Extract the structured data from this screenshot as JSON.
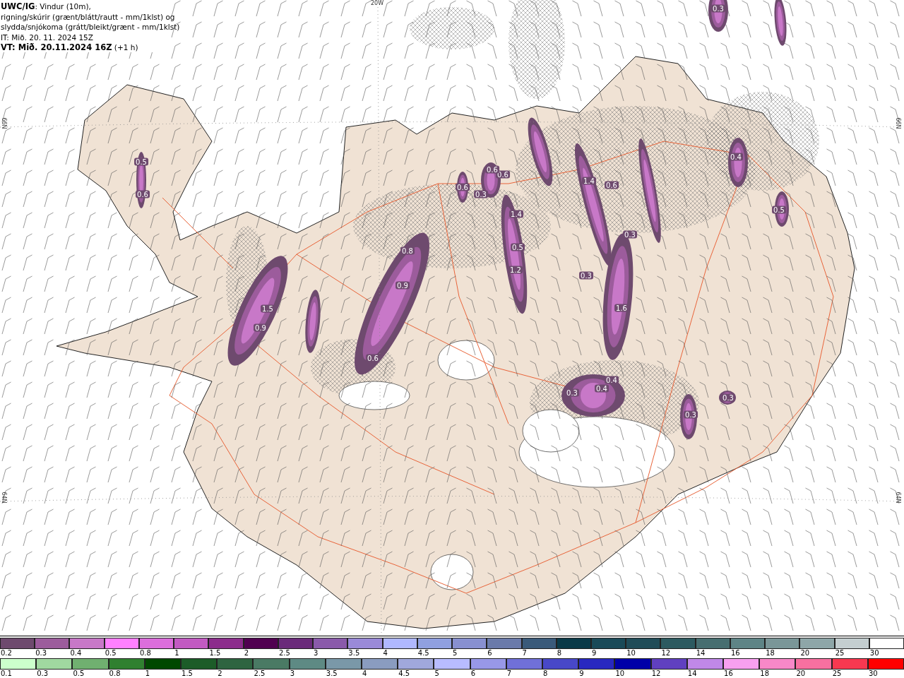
{
  "header": {
    "lines": [
      "**UWC/IG**: Vindur (10m),",
      "rigning/skúrir (grænt/blátt/rautt - mm/1klst) og",
      "slydda/snjókoma (grátt/bleikt/grænt - mm/1klst)",
      "IT: Mið. 20. 11. 2024 15Z",
      "**VT: Mið. 20.11.2024 16Z** (+1 h)"
    ]
  },
  "map": {
    "top_label": "20W",
    "left_labels": [
      "66N",
      "64N"
    ],
    "right_labels": [
      "66N",
      "64N"
    ],
    "precip_labels": [
      "0.3",
      "0.5",
      "0.6",
      "1.5",
      "0.9",
      "0.8",
      "0.9",
      "0.6",
      "0.6",
      "0.6",
      "0.3",
      "0.6",
      "1.4",
      "0.5",
      "1.2",
      "1.4",
      "0.6",
      "0.3",
      "0.3",
      "1.6",
      "0.4",
      "0.4",
      "0.3",
      "0.3",
      "0.3",
      "0.4",
      "0.5"
    ]
  },
  "legend": {
    "rows": [
      {
        "items": [
          {
            "label": "0.2",
            "color": "#6e4a6e"
          },
          {
            "label": "0.3",
            "color": "#9c5c9c"
          },
          {
            "label": "0.4",
            "color": "#c878c8"
          },
          {
            "label": "0.5",
            "color": "#ff80ff"
          },
          {
            "label": "0.8",
            "color": "#dc6edc"
          },
          {
            "label": "1",
            "color": "#c25ac2"
          },
          {
            "label": "1.5",
            "color": "#8c2c8c"
          },
          {
            "label": "2",
            "color": "#500050"
          },
          {
            "label": "2.5",
            "color": "#6a2a7a"
          },
          {
            "label": "3",
            "color": "#8a5aaa"
          },
          {
            "label": "3.5",
            "color": "#9a8ad8"
          },
          {
            "label": "4",
            "color": "#b0b8ff"
          },
          {
            "label": "4.5",
            "color": "#90a0e0"
          },
          {
            "label": "5",
            "color": "#8890d0"
          },
          {
            "label": "6",
            "color": "#6a7aaa"
          },
          {
            "label": "7",
            "color": "#3a5a7a"
          },
          {
            "label": "8",
            "color": "#0a3a48"
          },
          {
            "label": "9",
            "color": "#1a4a58"
          },
          {
            "label": "10",
            "color": "#204c58"
          },
          {
            "label": "12",
            "color": "#2c5a60"
          },
          {
            "label": "14",
            "color": "#466e70"
          },
          {
            "label": "16",
            "color": "#5e8486"
          },
          {
            "label": "18",
            "color": "#7a9698"
          },
          {
            "label": "20",
            "color": "#8ea6a8"
          },
          {
            "label": "25",
            "color": "#c4ced0"
          },
          {
            "label": "30",
            "color": "#ffffff"
          }
        ]
      },
      {
        "items": [
          {
            "label": "0.1",
            "color": "#ccffcc"
          },
          {
            "label": "0.3",
            "color": "#a0d8a0"
          },
          {
            "label": "0.5",
            "color": "#70b070"
          },
          {
            "label": "0.8",
            "color": "#308030"
          },
          {
            "label": "1",
            "color": "#004800"
          },
          {
            "label": "1.5",
            "color": "#1c5c28"
          },
          {
            "label": "2",
            "color": "#2e6440"
          },
          {
            "label": "2.5",
            "color": "#4a7a64"
          },
          {
            "label": "3",
            "color": "#5e8a84"
          },
          {
            "label": "3.5",
            "color": "#7a98a8"
          },
          {
            "label": "4",
            "color": "#8a9cc0"
          },
          {
            "label": "4.5",
            "color": "#a0a8dc"
          },
          {
            "label": "5",
            "color": "#b8bcff"
          },
          {
            "label": "6",
            "color": "#9898e8"
          },
          {
            "label": "7",
            "color": "#7070d8"
          },
          {
            "label": "8",
            "color": "#4848c8"
          },
          {
            "label": "9",
            "color": "#2828c0"
          },
          {
            "label": "10",
            "color": "#0000a8"
          },
          {
            "label": "12",
            "color": "#6040c0"
          },
          {
            "label": "14",
            "color": "#c088e8"
          },
          {
            "label": "16",
            "color": "#f8a0f0"
          },
          {
            "label": "18",
            "color": "#f888c8"
          },
          {
            "label": "20",
            "color": "#f870a0"
          },
          {
            "label": "25",
            "color": "#f83850"
          },
          {
            "label": "30",
            "color": "#ff0000"
          }
        ]
      }
    ]
  }
}
